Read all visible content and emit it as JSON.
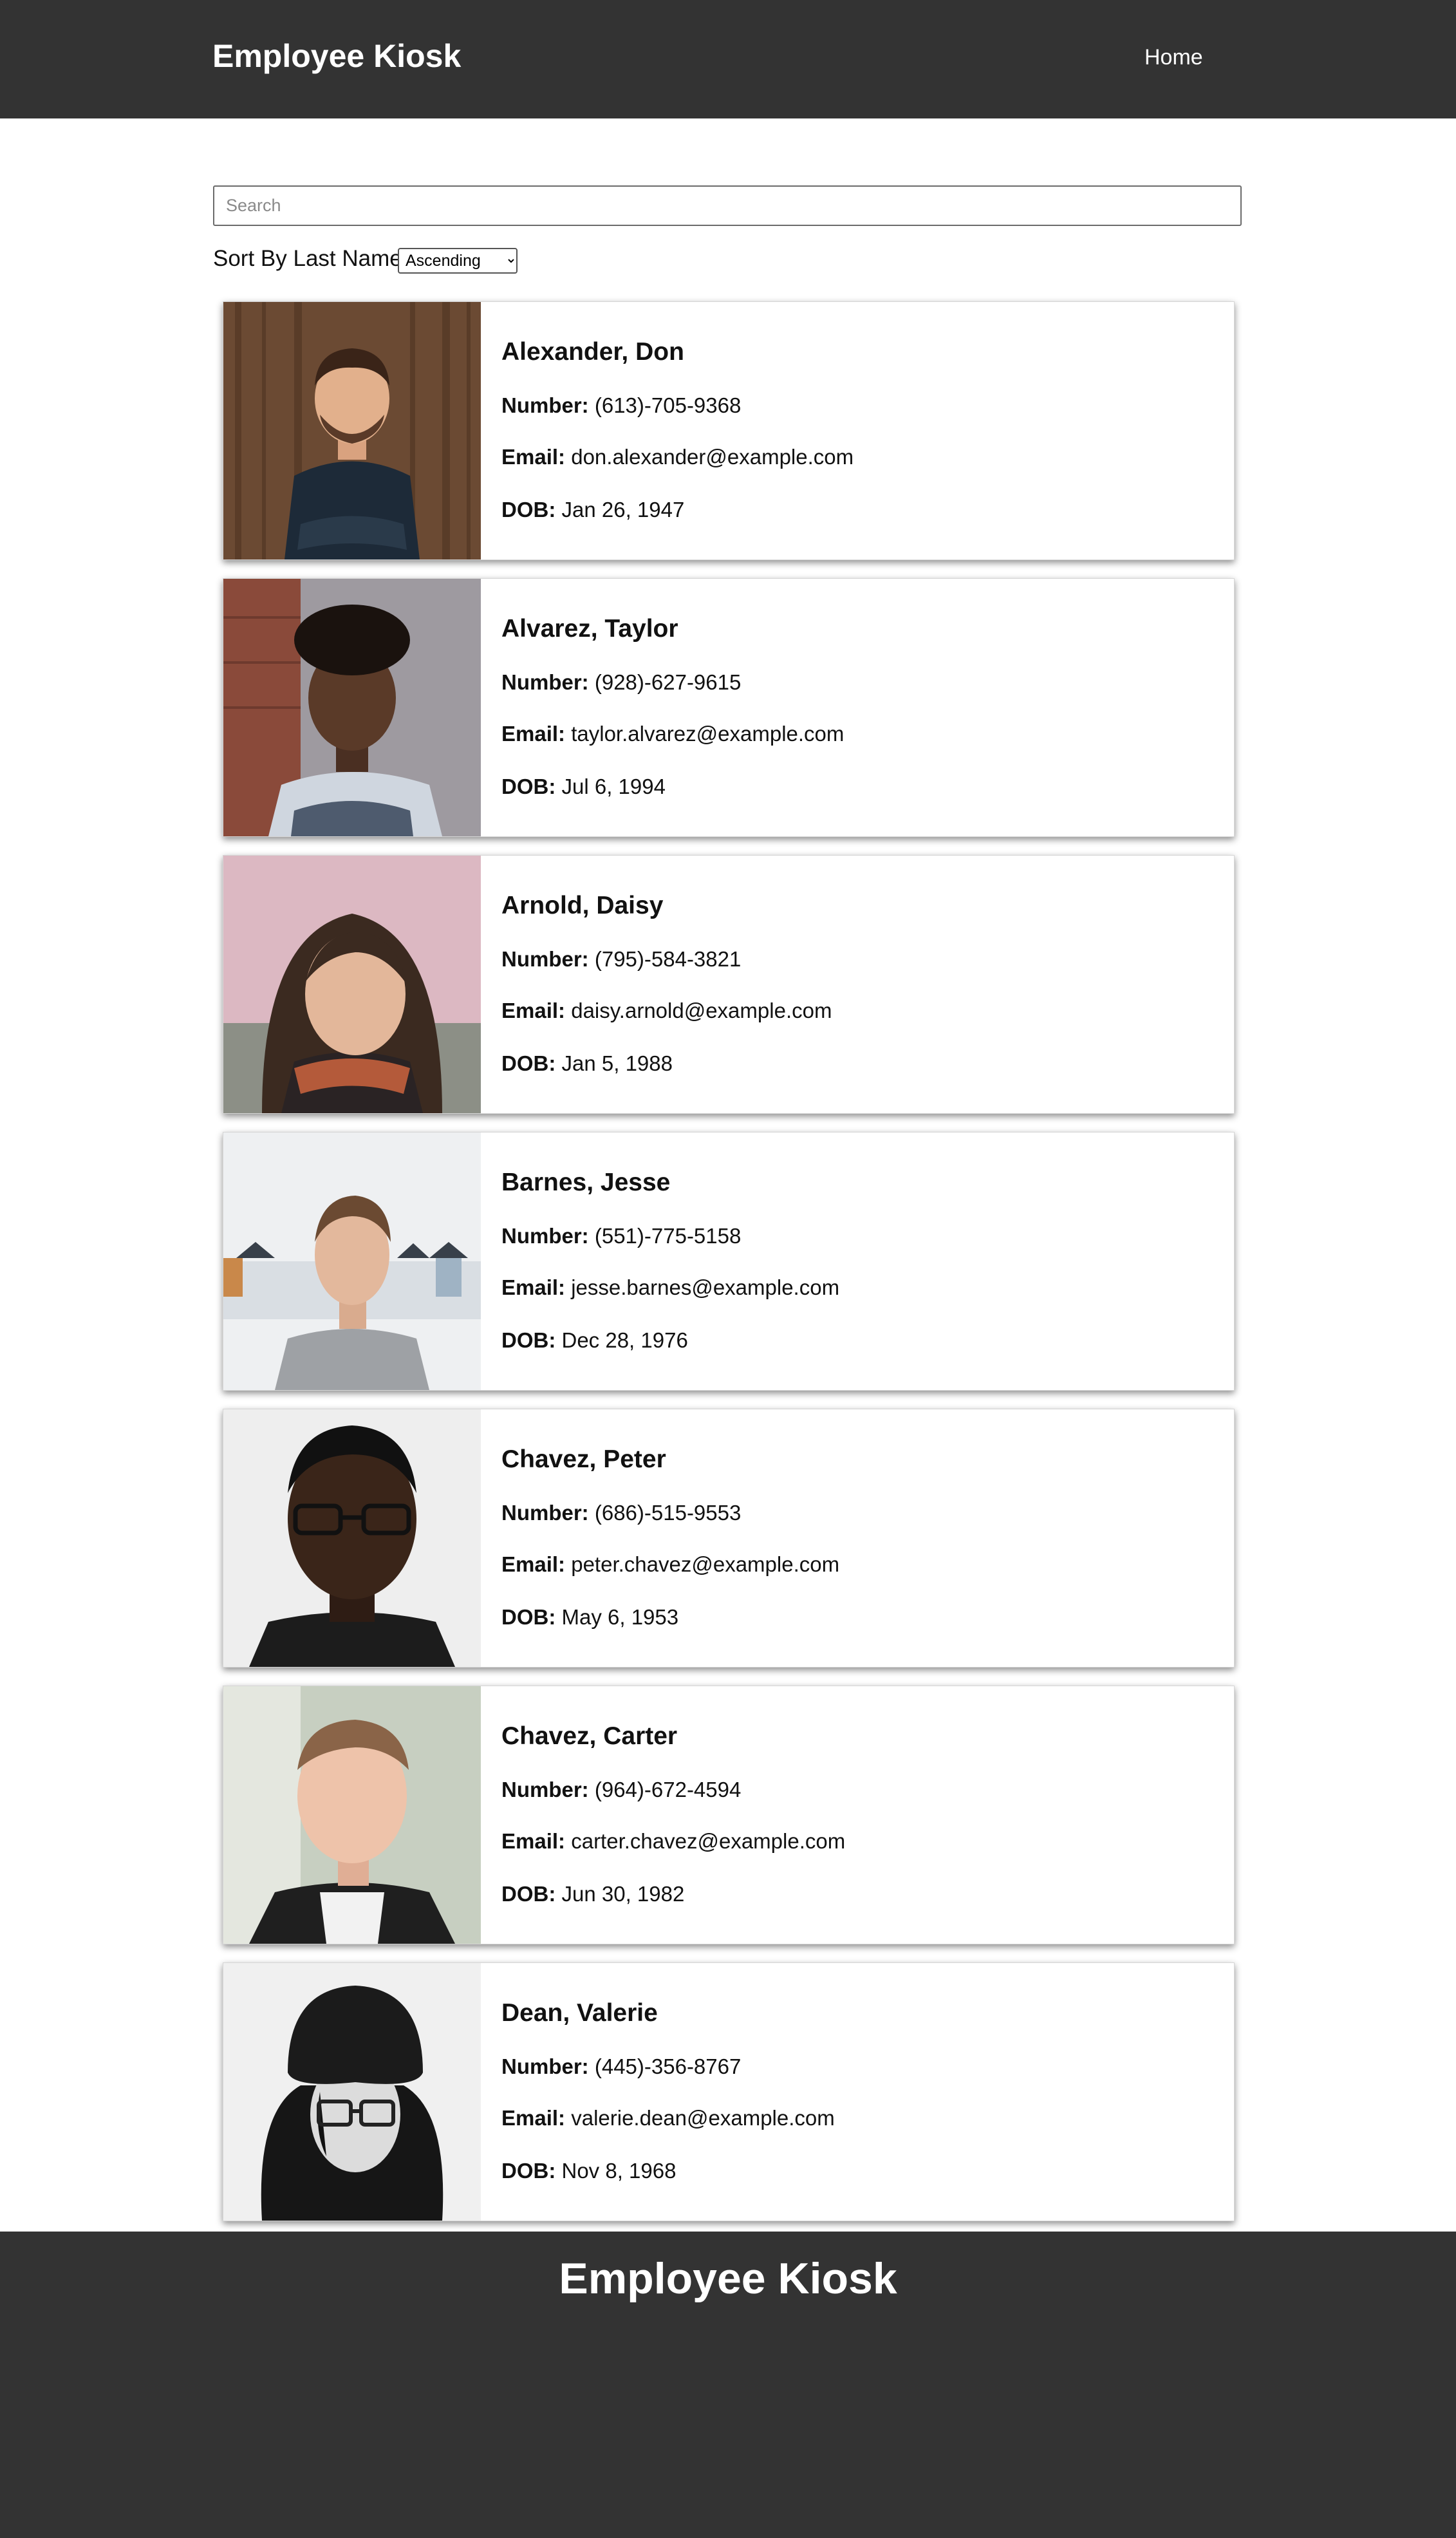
{
  "header": {
    "brand": "Employee Kiosk",
    "nav_home": "Home"
  },
  "search": {
    "placeholder": "Search",
    "value": ""
  },
  "sort": {
    "label": "Sort By Last Name:",
    "selected": "Ascending"
  },
  "field_labels": {
    "number": "Number:",
    "email": "Email:",
    "dob": "DOB:"
  },
  "employees": [
    {
      "name": "Alexander, Don",
      "number": "(613)-705-9368",
      "email": "don.alexander@example.com",
      "dob": "Jan 26, 1947"
    },
    {
      "name": "Alvarez, Taylor",
      "number": "(928)-627-9615",
      "email": "taylor.alvarez@example.com",
      "dob": "Jul 6, 1994"
    },
    {
      "name": "Arnold, Daisy",
      "number": "(795)-584-3821",
      "email": "daisy.arnold@example.com",
      "dob": "Jan 5, 1988"
    },
    {
      "name": "Barnes, Jesse",
      "number": "(551)-775-5158",
      "email": "jesse.barnes@example.com",
      "dob": "Dec 28, 1976"
    },
    {
      "name": "Chavez, Peter",
      "number": "(686)-515-9553",
      "email": "peter.chavez@example.com",
      "dob": "May 6, 1953"
    },
    {
      "name": "Chavez, Carter",
      "number": "(964)-672-4594",
      "email": "carter.chavez@example.com",
      "dob": "Jun 30, 1982"
    },
    {
      "name": "Dean, Valerie",
      "number": "(445)-356-8767",
      "email": "valerie.dean@example.com",
      "dob": "Nov 8, 1968"
    }
  ],
  "footer": {
    "title": "Employee Kiosk"
  }
}
